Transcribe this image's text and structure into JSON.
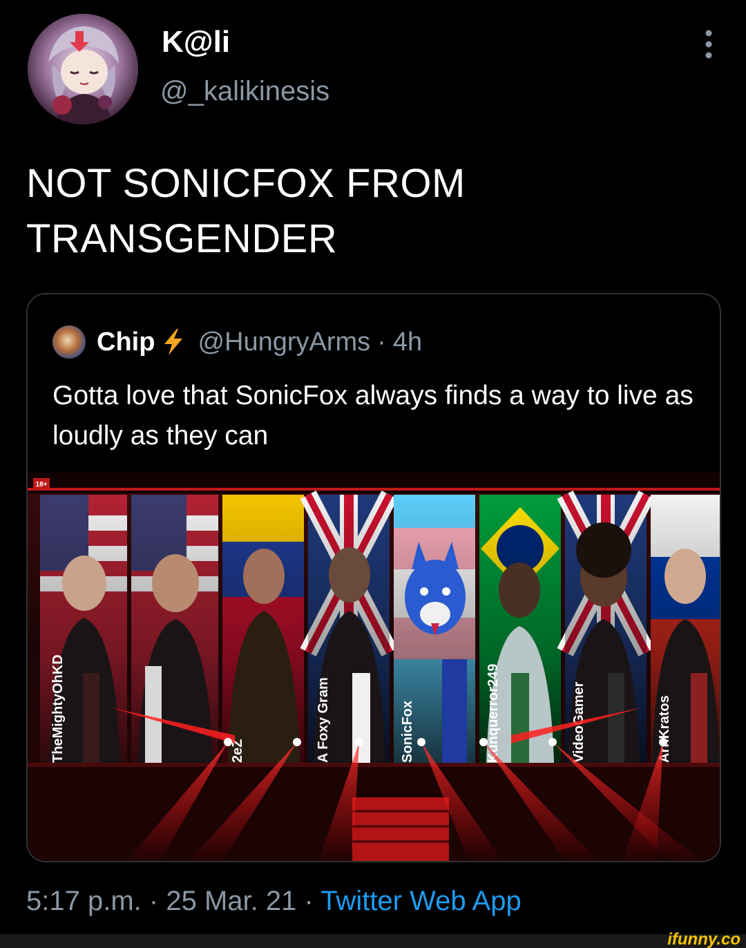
{
  "author": {
    "name": "K@li",
    "handle": "@_kalikinesis"
  },
  "tweet": {
    "text_line1": "NOT SONICFOX FROM",
    "text_line2": "TRANSGENDER",
    "time": "5:17 p.m.",
    "date": "25 Mar. 21",
    "separator": "·",
    "source": "Twitter Web App"
  },
  "quoted_tweet": {
    "name": "Chip",
    "handle": "@HungryArms",
    "separator": "·",
    "time": "4h",
    "text": "Gotta love that SonicFox always finds a way to live as loudly as they can",
    "media": {
      "age_badge": "18+",
      "player_names": [
        "TheMightyOhKD",
        "2eZ",
        "A Foxy Gram",
        "SonicFox",
        "Kunquerror249",
        "VideoGamer",
        "ArnKratos"
      ]
    }
  },
  "watermark": "ifunny.co",
  "colors": {
    "background": "#000000",
    "text": "#ffffff",
    "secondary_text": "#8b98a5",
    "link": "#1d9bf0",
    "border": "#2f3336",
    "bolt": "#f5a623",
    "stage_red": "#e01818"
  },
  "icons": {
    "more": "vertical-dots-icon",
    "badge": "lightning-bolt-icon"
  }
}
